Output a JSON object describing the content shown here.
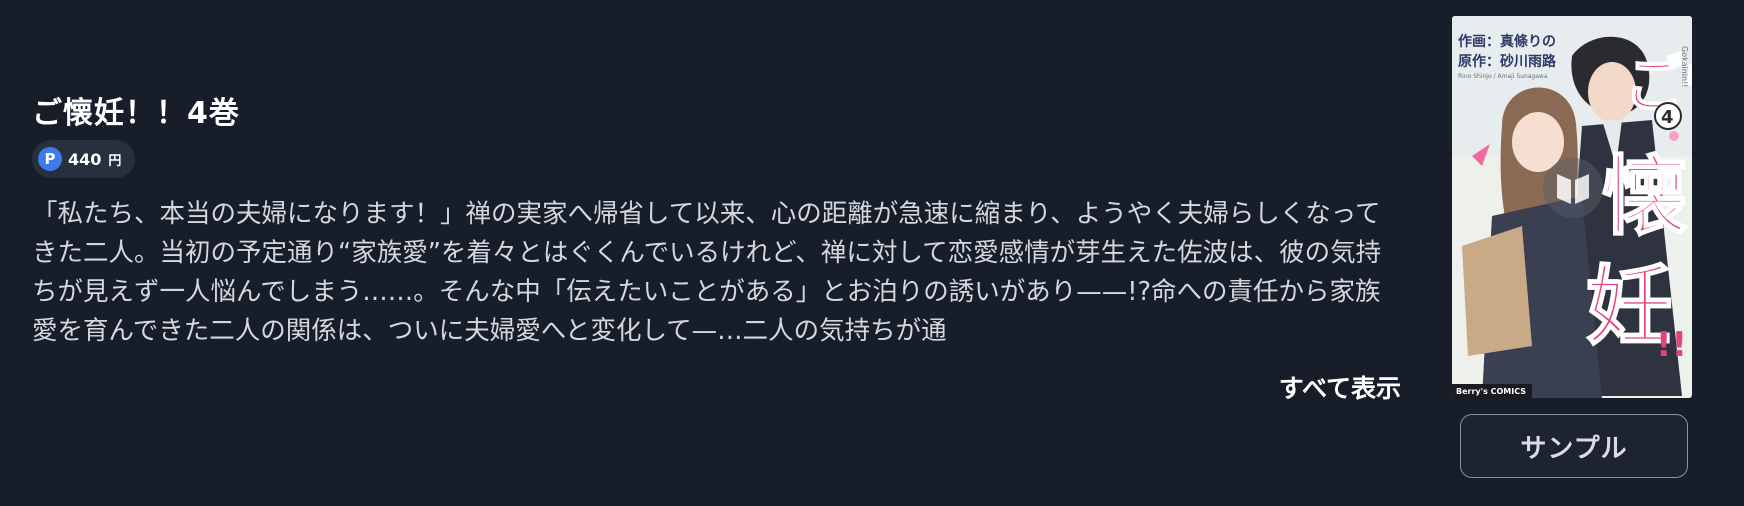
{
  "book": {
    "title": "ご懐妊！！4巻",
    "price": {
      "icon": "point-icon",
      "icon_glyph": "P",
      "value": "440",
      "unit": "円"
    },
    "description": "「私たち、本当の夫婦になります！」禅の実家へ帰省して以来、心の距離が急速に縮まり、ようやく夫婦らしくなってきた二人。当初の予定通り“家族愛”を着々とはぐくんでいるけれど、禅に対して恋愛感情が芽生えた佐波は、彼の気持ちが見えず一人悩んでしまう……。そんな中「伝えたいことがある」とお泊りの誘いがあり——!?命への責任から家族愛を育んできた二人の関係は、ついに夫婦愛へと変化して—…二人の気持ちが通",
    "show_all_label": "すべて表示",
    "sample_label": "サンプル"
  },
  "cover": {
    "title_art": "ご懐妊!!",
    "volume": "4",
    "credit_art": "作画：真條りの",
    "credit_original": "原作：砂川雨路",
    "romaji_title": "Gokainin!!",
    "romaji_credits": "Rino Shinjo / Amaji Sunagawa",
    "publisher": "Berry's COMICS",
    "overlay_icon": "open-book-icon"
  },
  "colors": {
    "background": "#171d29",
    "accent_blue": "#3d7be8",
    "cover_pink": "#e0447a",
    "text_secondary": "#d3d7de"
  }
}
